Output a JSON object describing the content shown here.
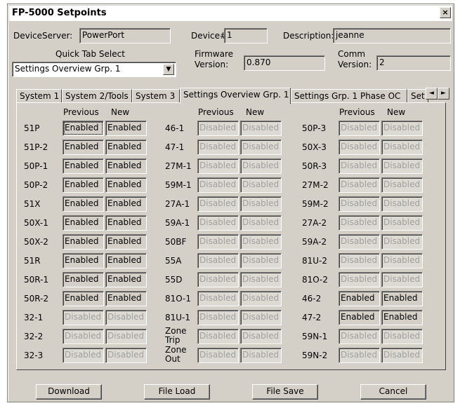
{
  "window": {
    "title": "FP-5000 Setpoints",
    "close_glyph": "×"
  },
  "header": {
    "device_server_label": "DeviceServer:",
    "device_server_value": "PowerPort",
    "device_num_label": "Device#",
    "device_num_value": "1",
    "description_label": "Description:",
    "description_value": "jeanne",
    "quick_tab_label": "Quick Tab Select",
    "quick_tab_value": "Settings Overview Grp. 1",
    "firmware_label_1": "Firmware",
    "firmware_label_2": "Version:",
    "firmware_value": "0.870",
    "comm_label_1": "Comm",
    "comm_label_2": "Version:",
    "comm_value": "2"
  },
  "tabs": [
    {
      "label": "System 1"
    },
    {
      "label": "System 2/Tools"
    },
    {
      "label": "System 3"
    },
    {
      "label": "Settings Overview Grp. 1"
    },
    {
      "label": "Settings Grp. 1 Phase OC"
    },
    {
      "label": "Set"
    }
  ],
  "tab_scroll": {
    "left": "◄",
    "right": "►"
  },
  "columns": {
    "previous": "Previous",
    "new": "New"
  },
  "groups": [
    {
      "rows": [
        {
          "label": "51P",
          "previous": "Enabled",
          "new": "Enabled",
          "enabled": true
        },
        {
          "label": "51P-2",
          "previous": "Enabled",
          "new": "Enabled",
          "enabled": true
        },
        {
          "label": "50P-1",
          "previous": "Enabled",
          "new": "Enabled",
          "enabled": true
        },
        {
          "label": "50P-2",
          "previous": "Enabled",
          "new": "Enabled",
          "enabled": true
        },
        {
          "label": "51X",
          "previous": "Enabled",
          "new": "Enabled",
          "enabled": true
        },
        {
          "label": "50X-1",
          "previous": "Enabled",
          "new": "Enabled",
          "enabled": true
        },
        {
          "label": "50X-2",
          "previous": "Enabled",
          "new": "Enabled",
          "enabled": true
        },
        {
          "label": "51R",
          "previous": "Enabled",
          "new": "Enabled",
          "enabled": true
        },
        {
          "label": "50R-1",
          "previous": "Enabled",
          "new": "Enabled",
          "enabled": true
        },
        {
          "label": "50R-2",
          "previous": "Enabled",
          "new": "Enabled",
          "enabled": true
        },
        {
          "label": "32-1",
          "previous": "Disabled",
          "new": "Disabled",
          "enabled": false
        },
        {
          "label": "32-2",
          "previous": "Disabled",
          "new": "Disabled",
          "enabled": false
        },
        {
          "label": "32-3",
          "previous": "Disabled",
          "new": "Disabled",
          "enabled": false
        }
      ]
    },
    {
      "rows": [
        {
          "label": "46-1",
          "previous": "Disabled",
          "new": "Disabled",
          "enabled": false
        },
        {
          "label": "47-1",
          "previous": "Disabled",
          "new": "Disabled",
          "enabled": false
        },
        {
          "label": "27M-1",
          "previous": "Disabled",
          "new": "Disabled",
          "enabled": false
        },
        {
          "label": "59M-1",
          "previous": "Disabled",
          "new": "Disabled",
          "enabled": false
        },
        {
          "label": "27A-1",
          "previous": "Disabled",
          "new": "Disabled",
          "enabled": false
        },
        {
          "label": "59A-1",
          "previous": "Disabled",
          "new": "Disabled",
          "enabled": false
        },
        {
          "label": "50BF",
          "previous": "Disabled",
          "new": "Disabled",
          "enabled": false
        },
        {
          "label": "55A",
          "previous": "Disabled",
          "new": "Disabled",
          "enabled": false
        },
        {
          "label": "55D",
          "previous": "Disabled",
          "new": "Disabled",
          "enabled": false
        },
        {
          "label": "81O-1",
          "previous": "Disabled",
          "new": "Disabled",
          "enabled": false
        },
        {
          "label": "81U-1",
          "previous": "Disabled",
          "new": "Disabled",
          "enabled": false
        },
        {
          "label": "Zone\nTrip",
          "previous": "Disabled",
          "new": "Disabled",
          "enabled": false
        },
        {
          "label": "Zone\nOut",
          "previous": "Disabled",
          "new": "Disabled",
          "enabled": false
        }
      ]
    },
    {
      "rows": [
        {
          "label": "50P-3",
          "previous": "Disabled",
          "new": "Disabled",
          "enabled": false
        },
        {
          "label": "50X-3",
          "previous": "Disabled",
          "new": "Disabled",
          "enabled": false
        },
        {
          "label": "50R-3",
          "previous": "Disabled",
          "new": "Disabled",
          "enabled": false
        },
        {
          "label": "27M-2",
          "previous": "Disabled",
          "new": "Disabled",
          "enabled": false
        },
        {
          "label": "59M-2",
          "previous": "Disabled",
          "new": "Disabled",
          "enabled": false
        },
        {
          "label": "27A-2",
          "previous": "Disabled",
          "new": "Disabled",
          "enabled": false
        },
        {
          "label": "59A-2",
          "previous": "Disabled",
          "new": "Disabled",
          "enabled": false
        },
        {
          "label": "81U-2",
          "previous": "Disabled",
          "new": "Disabled",
          "enabled": false
        },
        {
          "label": "81O-2",
          "previous": "Disabled",
          "new": "Disabled",
          "enabled": false
        },
        {
          "label": "46-2",
          "previous": "Enabled",
          "new": "Enabled",
          "enabled": true
        },
        {
          "label": "47-2",
          "previous": "Enabled",
          "new": "Enabled",
          "enabled": true
        },
        {
          "label": "59N-1",
          "previous": "Disabled",
          "new": "Disabled",
          "enabled": false
        },
        {
          "label": "59N-2",
          "previous": "Disabled",
          "new": "Disabled",
          "enabled": false
        }
      ]
    }
  ],
  "buttons": {
    "download": "Download",
    "file_load": "File Load",
    "file_save": "File Save",
    "cancel": "Cancel"
  }
}
